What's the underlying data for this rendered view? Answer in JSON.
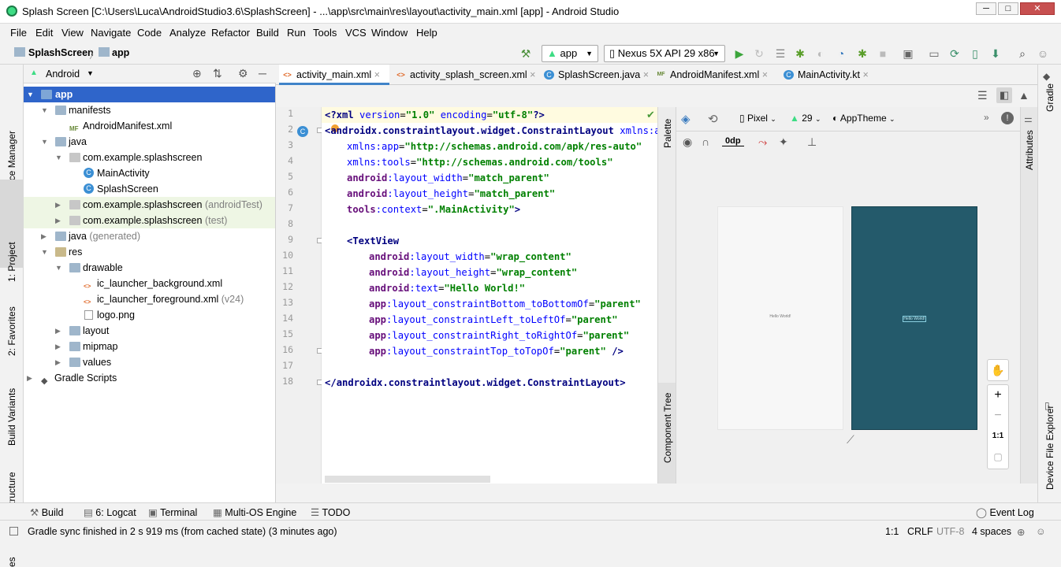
{
  "window": {
    "title": "Splash Screen [C:\\Users\\Luca\\AndroidStudio3.6\\SplashScreen] - ...\\app\\src\\main\\res\\layout\\activity_main.xml [app] - Android Studio",
    "minimize": "─",
    "maximize": "□",
    "close": "✕"
  },
  "menu": [
    "File",
    "Edit",
    "View",
    "Navigate",
    "Code",
    "Analyze",
    "Refactor",
    "Build",
    "Run",
    "Tools",
    "VCS",
    "Window",
    "Help"
  ],
  "breadcrumb": {
    "project": "SplashScreen",
    "module": "app"
  },
  "toolbar": {
    "run_config": "app",
    "device": "Nexus 5X API 29 x86"
  },
  "left_tools": [
    "Resource Manager",
    "1: Project",
    "2: Favorites",
    "Build Variants",
    "Z: Structure",
    "es"
  ],
  "project_panel": {
    "view_mode": "Android",
    "tree": [
      {
        "label": "app",
        "suffix": "",
        "selected": true
      },
      {
        "label": "manifests",
        "suffix": ""
      },
      {
        "label": "AndroidManifest.xml",
        "suffix": ""
      },
      {
        "label": "java",
        "suffix": ""
      },
      {
        "label": "com.example.splashscreen",
        "suffix": ""
      },
      {
        "label": "MainActivity",
        "suffix": ""
      },
      {
        "label": "SplashScreen",
        "suffix": ""
      },
      {
        "label": "com.example.splashscreen",
        "suffix": "(androidTest)"
      },
      {
        "label": "com.example.splashscreen",
        "suffix": "(test)"
      },
      {
        "label": "java",
        "suffix": "(generated)"
      },
      {
        "label": "res",
        "suffix": ""
      },
      {
        "label": "drawable",
        "suffix": ""
      },
      {
        "label": "ic_launcher_background.xml",
        "suffix": ""
      },
      {
        "label": "ic_launcher_foreground.xml",
        "suffix": "(v24)"
      },
      {
        "label": "logo.png",
        "suffix": ""
      },
      {
        "label": "layout",
        "suffix": ""
      },
      {
        "label": "mipmap",
        "suffix": ""
      },
      {
        "label": "values",
        "suffix": ""
      },
      {
        "label": "Gradle Scripts",
        "suffix": ""
      }
    ]
  },
  "editor_tabs": [
    "activity_main.xml",
    "activity_splash_screen.xml",
    "SplashScreen.java",
    "AndroidManifest.xml",
    "MainActivity.kt"
  ],
  "code_lines": [
    "1",
    "2",
    "3",
    "4",
    "5",
    "6",
    "7",
    "8",
    "9",
    "10",
    "11",
    "12",
    "13",
    "14",
    "15",
    "16",
    "17",
    "18"
  ],
  "code": {
    "l1_a": "<?xml ",
    "l1_b": "version",
    "l1_c": "=",
    "l1_d": "\"1.0\"",
    "l1_e": " encoding",
    "l1_f": "=",
    "l1_g": "\"utf-8\"",
    "l1_h": "?>",
    "l2_a": "<",
    "l2_b": "androidx.constraintlayout.widget.ConstraintLayout",
    "l2_c": " xmlns:and",
    "l3_a": "xmlns:app",
    "l3_b": "=",
    "l3_c": "\"http://schemas.android.com/apk/res-auto\"",
    "l4_a": "xmlns:tools",
    "l4_b": "=",
    "l4_c": "\"http://schemas.android.com/tools\"",
    "l5_a": "android",
    "l5_b": ":layout_width",
    "l5_c": "=",
    "l5_d": "\"match_parent\"",
    "l6_a": "android",
    "l6_b": ":layout_height",
    "l6_c": "=",
    "l6_d": "\"match_parent\"",
    "l7_a": "tools",
    "l7_b": ":context",
    "l7_c": "=",
    "l7_d": "\".MainActivity\"",
    "l7_e": ">",
    "l9_a": "<",
    "l9_b": "TextView",
    "l10_a": "android",
    "l10_b": ":layout_width",
    "l10_c": "=",
    "l10_d": "\"wrap_content\"",
    "l11_a": "android",
    "l11_b": ":layout_height",
    "l11_c": "=",
    "l11_d": "\"wrap_content\"",
    "l12_a": "android",
    "l12_b": ":text",
    "l12_c": "=",
    "l12_d": "\"Hello World!\"",
    "l13_a": "app",
    "l13_b": ":layout_constraintBottom_toBottomOf",
    "l13_c": "=",
    "l13_d": "\"parent\"",
    "l14_a": "app",
    "l14_b": ":layout_constraintLeft_toLeftOf",
    "l14_c": "=",
    "l14_d": "\"parent\"",
    "l15_a": "app",
    "l15_b": ":layout_constraintRight_toRightOf",
    "l15_c": "=",
    "l15_d": "\"parent\"",
    "l16_a": "app",
    "l16_b": ":layout_constraintTop_toTopOf",
    "l16_c": "=",
    "l16_d": "\"parent\"",
    "l16_e": " />",
    "l18_a": "</",
    "l18_b": "androidx.constraintlayout.widget.ConstraintLayout",
    "l18_c": ">"
  },
  "palette_label": "Palette",
  "component_tree_label": "Component Tree",
  "attributes_label": "Attributes",
  "gradle_label": "Gradle",
  "device_explorer_label": "Device File Explorer",
  "design": {
    "device": "Pixel",
    "api": "29",
    "theme": "AppTheme",
    "margin": "0dp",
    "preview_text": "Hello World!",
    "zoom_label": "1:1",
    "blueprint_color": "#245a6b"
  },
  "bottom_tools": [
    "Build",
    "6: Logcat",
    "Terminal",
    "Multi-OS Engine",
    "TODO"
  ],
  "event_log": "Event Log",
  "status": {
    "message": "Gradle sync finished in 2 s 919 ms (from cached state) (3 minutes ago)",
    "position": "1:1",
    "line_sep": "CRLF",
    "encoding": "UTF-8",
    "indent": "4 spaces"
  }
}
